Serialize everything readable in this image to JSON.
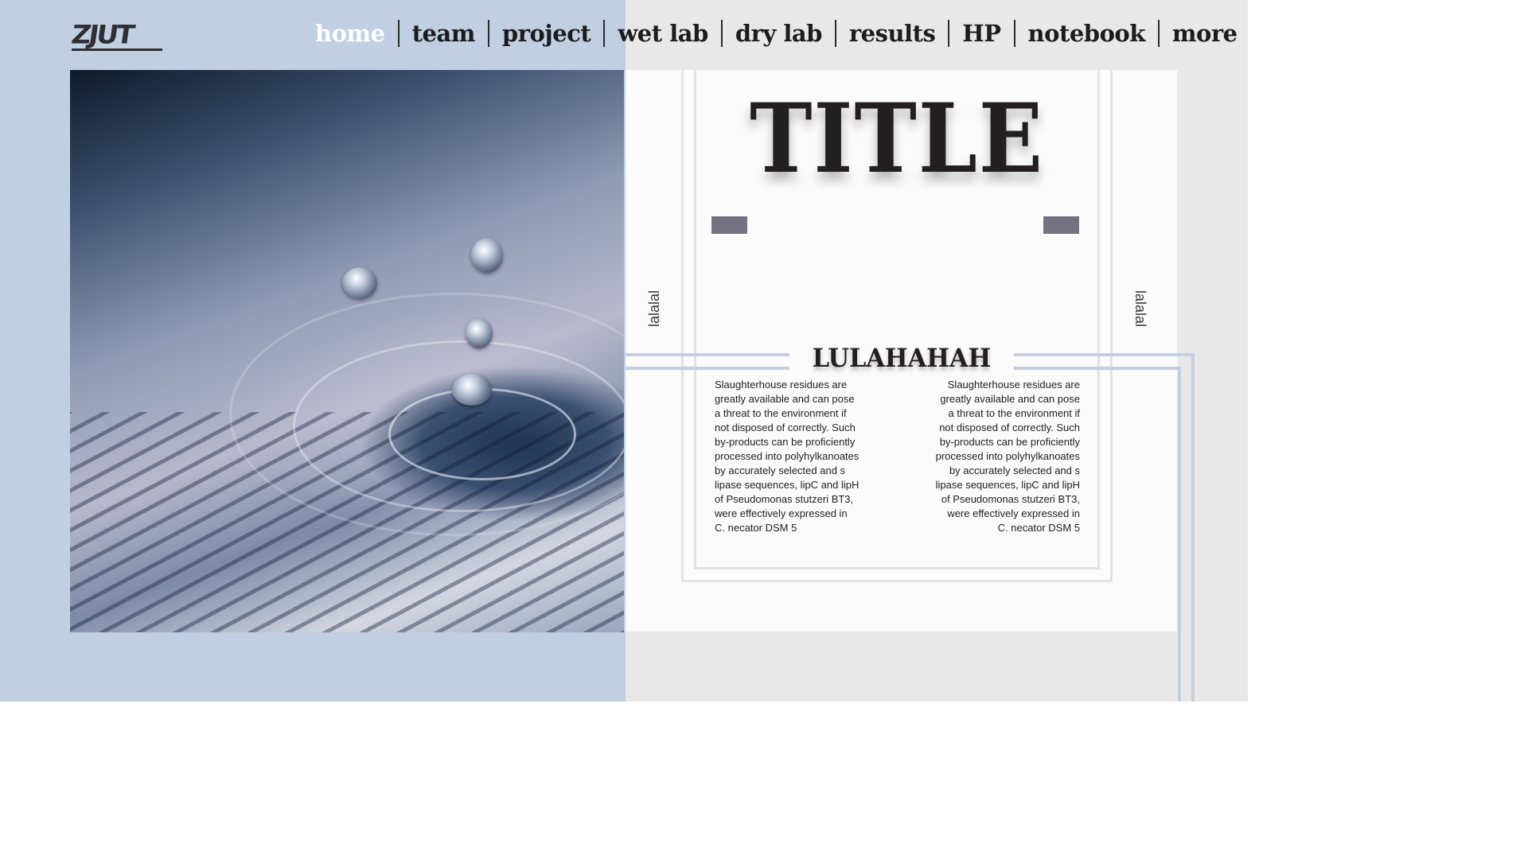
{
  "logo": {
    "text": "ZJUT"
  },
  "nav": {
    "items": [
      {
        "label": "home"
      },
      {
        "label": "team"
      },
      {
        "label": "project"
      },
      {
        "label": "wet lab"
      },
      {
        "label": "dry lab"
      },
      {
        "label": "results"
      },
      {
        "label": "HP"
      },
      {
        "label": "notebook"
      },
      {
        "label": "more"
      }
    ],
    "active": "home"
  },
  "hero": {
    "title": "TITLE",
    "subtitle": "LULAHAHAH",
    "side_left": "lalalal",
    "side_right": "lalalal",
    "paragraph_left": "Slaughterhouse residues are greatly available and can pose a threat to the environment if not disposed of correctly. Such by-products can be proficiently processed into polyhylkanoates by accurately selected and s lipase sequences, lipC and lipH of Pseudomonas stutzeri BT3, were effectively expressed in C. necator DSM 5",
    "paragraph_right": "Slaughterhouse residues are greatly available and can pose a threat to the environment if not disposed of correctly. Such by-products can be proficiently processed into polyhylkanoates by accurately selected and s lipase sequences, lipC and lipH of Pseudomonas stutzeri BT3, were effectively expressed in C. necator DSM 5"
  },
  "colors": {
    "left_background": "#c0d0e2",
    "right_background": "#e8e8e8",
    "card": "#fbfbfb",
    "title_text": "#231f20",
    "marker": "#74727e",
    "nav_active": "#ffffff"
  },
  "image": {
    "icon": "water-droplets-on-newspaper-photo"
  }
}
